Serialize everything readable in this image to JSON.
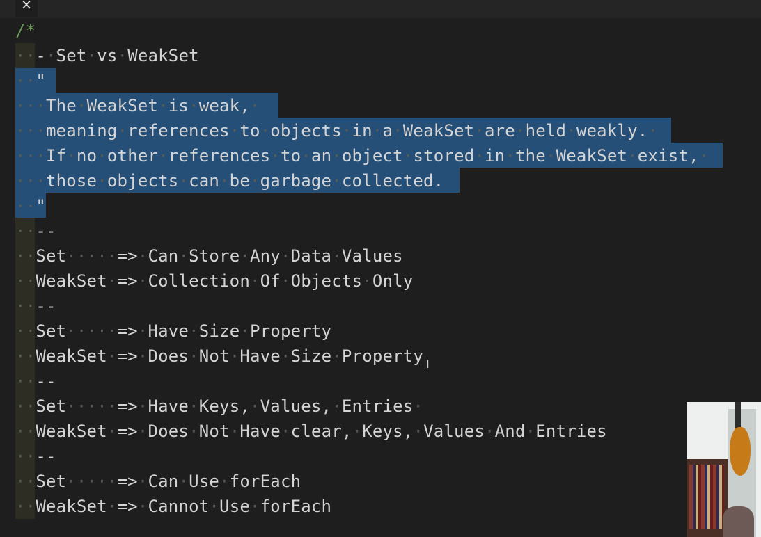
{
  "tab": {
    "close_glyph": "×"
  },
  "editor": {
    "lines": [
      "/*",
      "··-·Set·vs·WeakSet",
      "··\"",
      "···The·WeakSet·is·weak,·",
      "···meaning·references·to·objects·in·a·WeakSet·are·held·weakly.·",
      "···If·no·other·references·to·an·object·stored·in·the·WeakSet·exist,·",
      "···those·objects·can·be·garbage·collected.",
      "··\"",
      "··--",
      "··Set·····=>·Can·Store·Any·Data·Values",
      "··WeakSet·=>·Collection·Of·Objects·Only",
      "··--",
      "··Set·····=>·Have·Size·Property",
      "··WeakSet·=>·Does·Not·Have·Size·Property",
      "··--",
      "··Set·····=>·Have·Keys,·Values,·Entries·",
      "··WeakSet·=>·Does·Not·Have·clear,·Keys,·Values·And·Entries",
      "··--",
      "··Set·····=>·Can·Use·forEach",
      "··WeakSet·=>·Cannot·Use·forEach"
    ]
  },
  "colors": {
    "background": "#1e1e1e",
    "selection": "#264f78",
    "comment": "#6a9955",
    "text": "#d4d4d4"
  }
}
